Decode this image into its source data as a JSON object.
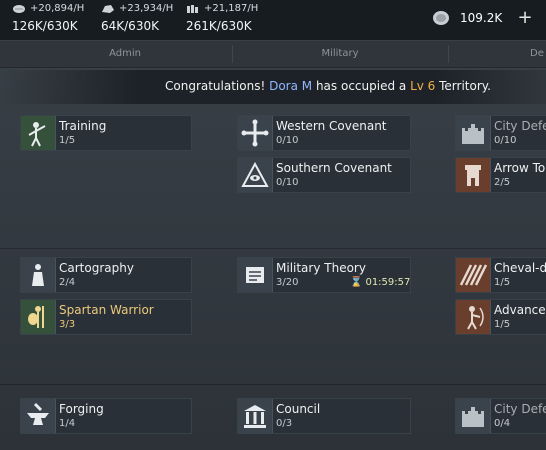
{
  "resources": [
    {
      "icon": "food-icon",
      "rate": "+20,894/H",
      "amount": "126K/630K"
    },
    {
      "icon": "stone-icon",
      "rate": "+23,934/H",
      "amount": "64K/630K"
    },
    {
      "icon": "wood-icon",
      "rate": "+21,187/H",
      "amount": "261K/630K"
    }
  ],
  "gems": {
    "icon": "silver-coin-icon",
    "value": "109.2K",
    "plus": "+"
  },
  "tabs": [
    "Admin",
    "Military",
    "De"
  ],
  "banner": {
    "prefix": "Congratulations! ",
    "name": "Dora M",
    "middle": " has occupied a ",
    "level": "Lv 6",
    "suffix": " Territory."
  },
  "techs": {
    "training": {
      "title": "Training",
      "count": "1/5",
      "icon": "soldier-training-icon"
    },
    "western_covenant": {
      "title": "Western Covenant",
      "count": "0/10",
      "icon": "cross-emblem-icon"
    },
    "city_defense_1": {
      "title": "City Defe",
      "count": "0/10",
      "icon": "castle-icon"
    },
    "southern_covenant": {
      "title": "Southern Covenant",
      "count": "0/10",
      "icon": "pyramid-eye-icon"
    },
    "arrow_tower": {
      "title": "Arrow To",
      "count": "2/5",
      "icon": "tower-icon"
    },
    "cartography": {
      "title": "Cartography",
      "count": "2/4",
      "icon": "map-figure-icon"
    },
    "military_theory": {
      "title": "Military Theory",
      "count": "3/20",
      "icon": "scroll-icon",
      "timer": "01:59:57"
    },
    "cheval_de_frise": {
      "title": "Cheval-de",
      "count": "1/5",
      "icon": "spikes-icon"
    },
    "spartan_warrior": {
      "title": "Spartan Warrior",
      "count": "3/3",
      "icon": "spartan-icon"
    },
    "advanced": {
      "title": "Advanced",
      "count": "1/5",
      "icon": "archer-icon"
    },
    "forging": {
      "title": "Forging",
      "count": "1/4",
      "icon": "anvil-icon"
    },
    "council": {
      "title": "Council",
      "count": "0/3",
      "icon": "temple-icon"
    },
    "city_defense_2": {
      "title": "City Defe",
      "count": "0/4",
      "icon": "castle-icon"
    }
  }
}
